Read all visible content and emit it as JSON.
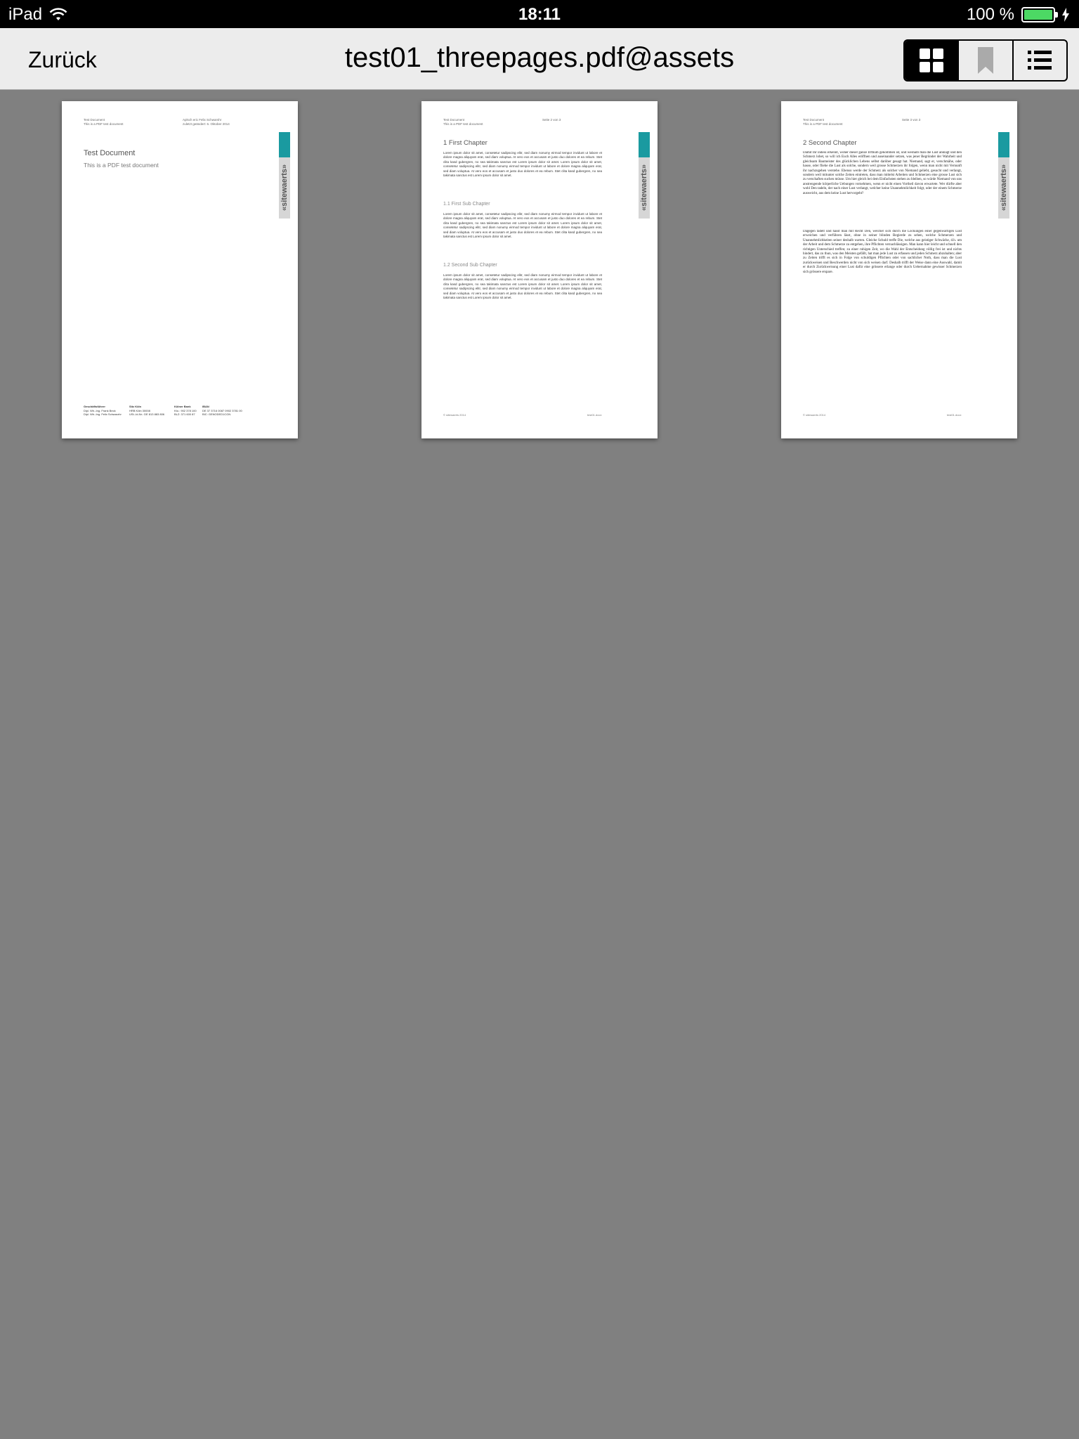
{
  "status_bar": {
    "device": "iPad",
    "time": "18:11",
    "battery_text": "100 %",
    "battery_level": 1.0,
    "battery_color": "#4cd964"
  },
  "nav": {
    "back_label": "Zurück",
    "title": "test01_threepages.pdf@assets",
    "segments": [
      {
        "icon": "grid-icon",
        "active": true
      },
      {
        "icon": "bookmark-icon",
        "active": false
      },
      {
        "icon": "list-icon",
        "active": false
      }
    ]
  },
  "brand": {
    "word": "«sitewaerts»",
    "accent_color": "#1a9aa0"
  },
  "pages": [
    {
      "header_left": [
        "Test Document",
        "This is a PDF test document"
      ],
      "header_right": [
        "Aplsch eric Felix Schwarshr",
        "zuletzt geändert: 6. Oktober 2014"
      ],
      "title": "Test Document",
      "subtitle": "This is a PDF test document",
      "imprint": [
        {
          "head": "Geschäftsführer",
          "lines": [
            "Dipl. Wh.-Ing. Frank Beck",
            "Dipl. Wh.-Ing. Felix Schwarzhr"
          ]
        },
        {
          "head": "Sitz Köln",
          "lines": [
            "HRB Köln 30008",
            "USt.-Id-Nr.: DE 813 883 806"
          ]
        },
        {
          "head": "Kölner Bank",
          "lines": [
            "Kto.: 902 378 100",
            "BLZ: 371 600 87"
          ]
        },
        {
          "head": "IBAN",
          "lines": [
            "DE 37 3716 0087 0902 3781 00",
            "BIC: GENODED1CGN"
          ]
        }
      ]
    },
    {
      "header_left": [
        "Test Document",
        "This is a PDF test document"
      ],
      "header_right": [
        "Seite 2 von 3"
      ],
      "chapter": "1  First Chapter",
      "lorem": "Lorem ipsum dolor sit amet, consetetur sadipscing elitr, sed diam nonumy eirmod tempor invidunt ut labore et dolore magna aliquyam erat, sed diam voluptua. At vero eos et accusam et justo duo dolores et ea rebum. Stet clita kasd gubergren, no sea takimata sanctus est Lorem ipsum dolor sit amet. Lorem ipsum dolor sit amet, consetetur sadipscing elitr, sed diam nonumy eirmod tempor invidunt ut labore et dolore magna aliquyam erat, sed diam voluptua. At vero eos et accusam et justo duo dolores et ea rebum. Stet clita kasd gubergren, no sea takimata sanctus est Lorem ipsum dolor sit amet.",
      "sub1": "1.1  First Sub Chapter",
      "sub2": "1.2  Second Sub Chapter",
      "footer_left": "© sitewaerts 2014",
      "footer_right": "test01.docx"
    },
    {
      "header_left": [
        "Test Document",
        "This is a PDF test document"
      ],
      "header_right": [
        "Seite 3 von 3"
      ],
      "chapter": "2  Second Chapter",
      "para1": "Damit Ihr indess erkennt, woher dieser ganze Irrthum gekommen ist, und weshalb man die Lust anklagt und den Schmerz lobet, so will ich Euch Alles eröffnen und auseinander setzen, was jener Begründer der Wahrheit und gleichsam Baumeister des glücklichen Lebens selbst darüber gesagt hat. Niemand, sagt er, verschmähe, oder hasse, oder fliehe die Lust als solche, sondern weil grosse Schmerzen ihr folgen, wenn man nicht mit Vernunft ihr nachzugehen verstehe. Ebenso werde der Schmerz als solcher von Niemand geliebt, gesucht und verlangt, sondern weil mitunter solche Zeiten eintreten, dass man mittelst Arbeiten und Schmerzen eine grosse Lust sich zu verschaften suchen müsse. Um hier gleich bei dem Einfachsten stehen zu bleiben, so würde Niemand von uns anstrengende körperliche Uebungen vornehmen, wenn er nicht einen Vortheil davon erwartete. Wer dürfte aber wohl Den tadeln, der nach einer Lust verlangt, welcher keine Unannehmlichkeit folgt, oder der einem Schmerze ausweicht, aus dem keine Lust hervorgeht?",
      "para2": "Dagegen tadelt und hasst man mit Recht Den, welcher sich durch die Lockungen einer gegenwärtigen Lust erweichen und verführen lässt, ohne in seiner blinden Begierde zu sehen, welche Schmerzen und Unannehmlichkeiten seiner deshalb warten. Gleiche Schuld treffe Die, welche aus geistiger Schwäche, d.h. um der Arbeit und dem Schmerze zu entgehen, ihre Pflichten vernachlässigen. Man kann hier leicht und schnell den richtigen Unterschied treffen; zu einer ruhigen Zeit, wo die Wahl der Entscheidung völlig frei ist und nichts hindert, das zu thun, was den Meisten gefällt, hat man jede Lust zu erfassen und jeden Schmerz abzuhalten; aber zu Zeiten trifft es sich in Folge von schuldigen Pflichten oder von sachlicher Noth, dass man die Lust zurückweisen und Beschwerden nicht von sich weisen darf. Deshalb trifft der Weise dann eine Auswahl, damit er durch Zurückweisung einer Lust dafür eine grössere erlange oder durch Uebernahme gewisser Schmerzen sich grössere erspare.",
      "footer_left": "© sitewaerts 2014",
      "footer_right": "test01.docx"
    }
  ]
}
